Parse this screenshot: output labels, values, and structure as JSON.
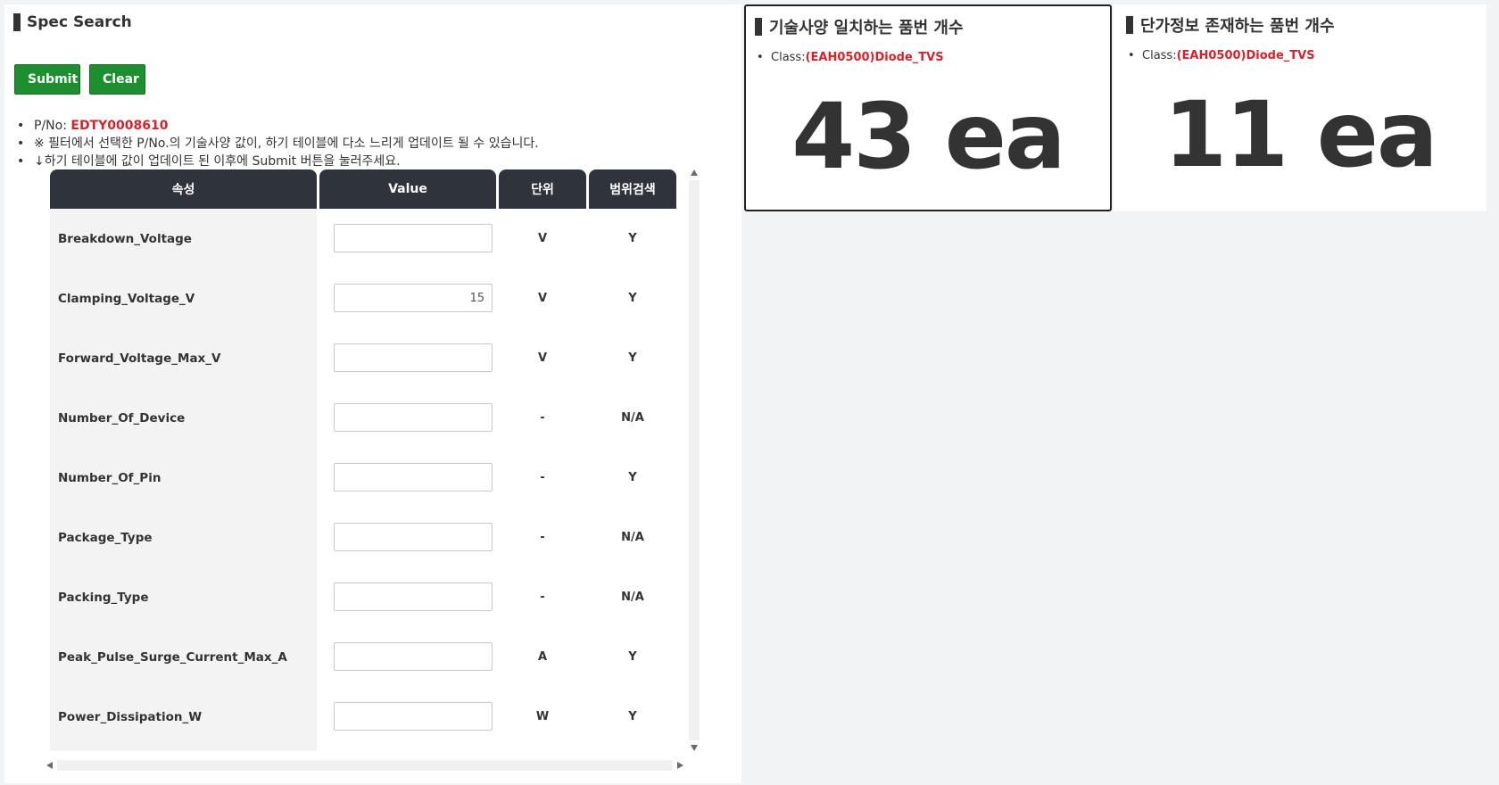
{
  "spec_search": {
    "title": "Spec Search",
    "submit_label": "Submit",
    "clear_label": "Clear",
    "notes": {
      "pno_label": "P/No: ",
      "pno_value": "EDTY0008610",
      "note_2": "※ 필터에서 선택한 P/No.의 기술사양 값이, 하기 테이블에 다소 느리게 업데이트 될 수 있습니다.",
      "note_3": "↓하기 테이블에 값이 업데이트 된 이후에 Submit 버튼을 눌러주세요."
    },
    "table": {
      "headers": {
        "attr": "속성",
        "value": "Value",
        "unit": "단위",
        "range": "범위검색"
      },
      "rows": [
        {
          "attr": "Breakdown_Voltage",
          "value": "",
          "unit": "V",
          "range": "Y"
        },
        {
          "attr": "Clamping_Voltage_V",
          "value": "15",
          "unit": "V",
          "range": "Y"
        },
        {
          "attr": "Forward_Voltage_Max_V",
          "value": "",
          "unit": "V",
          "range": "Y"
        },
        {
          "attr": "Number_Of_Device",
          "value": "",
          "unit": "-",
          "range": "N/A"
        },
        {
          "attr": "Number_Of_Pin",
          "value": "",
          "unit": "-",
          "range": "Y"
        },
        {
          "attr": "Package_Type",
          "value": "",
          "unit": "-",
          "range": "N/A"
        },
        {
          "attr": "Packing_Type",
          "value": "",
          "unit": "-",
          "range": "N/A"
        },
        {
          "attr": "Peak_Pulse_Surge_Current_Max_A",
          "value": "",
          "unit": "A",
          "range": "Y"
        },
        {
          "attr": "Power_Dissipation_W",
          "value": "",
          "unit": "W",
          "range": "Y"
        }
      ]
    }
  },
  "matching_card": {
    "title": "기술사양 일치하는 품번 개수",
    "class_label": "Class:",
    "class_value": "(EAH0500)Diode_TVS",
    "count": "43 ea"
  },
  "price_card": {
    "title": "단가정보 존재하는 품번 개수",
    "class_label": "Class:",
    "class_value": "(EAH0500)Diode_TVS",
    "count": "11 ea"
  },
  "colors": {
    "accent_green": "#1e8f2f",
    "header_dark": "#2f333b",
    "highlight_red": "#d3232c"
  }
}
